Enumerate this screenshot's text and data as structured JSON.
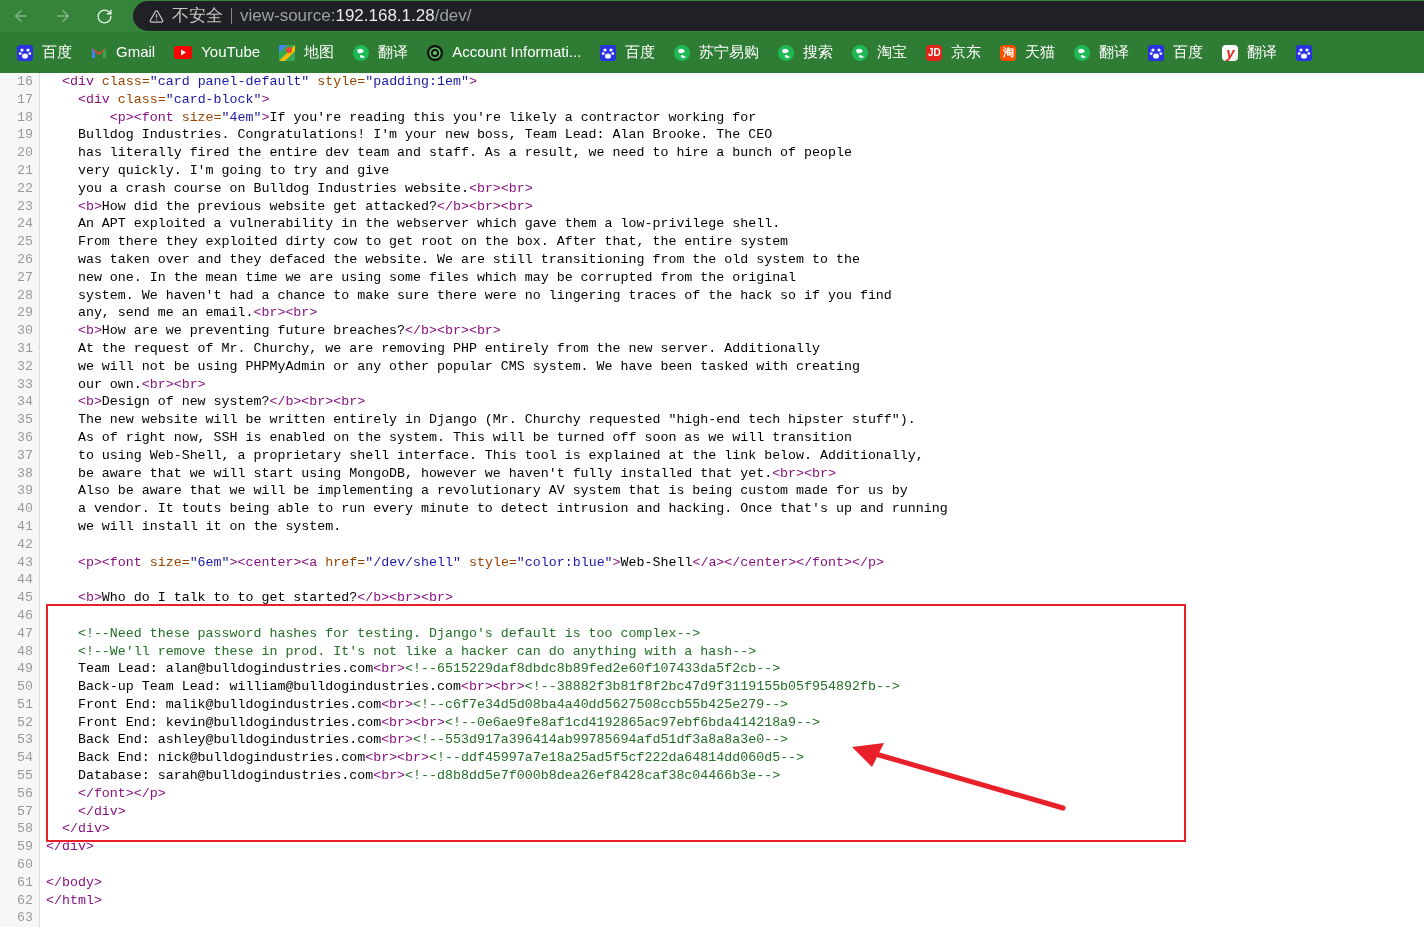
{
  "address_bar": {
    "security": "不安全",
    "scheme": "view-source:",
    "host": "192.168.1.28",
    "path": "/dev/"
  },
  "bookmarks": [
    {
      "kind": "paw",
      "label": "百度"
    },
    {
      "kind": "gmail",
      "label": "Gmail"
    },
    {
      "kind": "play",
      "label": "YouTube"
    },
    {
      "kind": "map",
      "label": "地图"
    },
    {
      "kind": "globe",
      "label": "翻译"
    },
    {
      "kind": "swirl",
      "label": "Account Informati..."
    },
    {
      "kind": "paw",
      "label": "百度"
    },
    {
      "kind": "globe",
      "label": "苏宁易购"
    },
    {
      "kind": "globe",
      "label": "搜索"
    },
    {
      "kind": "globe",
      "label": "淘宝"
    },
    {
      "kind": "letter-red",
      "icon_text": "JD",
      "label": "京东"
    },
    {
      "kind": "letter-orange",
      "icon_text": "淘",
      "label": "天猫"
    },
    {
      "kind": "globe",
      "label": "翻译"
    },
    {
      "kind": "paw",
      "label": "百度"
    },
    {
      "kind": "letter-plain",
      "icon_text": "y",
      "label": "翻译"
    },
    {
      "kind": "paw"
    }
  ],
  "source_lines": [
    {
      "number": "16",
      "segments": [
        {
          "kind": "tag",
          "text": "  <div "
        },
        {
          "kind": "attr",
          "text": "class="
        },
        {
          "kind": "value",
          "text": "\"card panel-default\""
        },
        {
          "kind": "attr",
          "text": " style="
        },
        {
          "kind": "value",
          "text": "\"padding:1em\""
        },
        {
          "kind": "tag",
          "text": ">"
        }
      ]
    },
    {
      "number": "17",
      "segments": [
        {
          "kind": "tag",
          "text": "    <div "
        },
        {
          "kind": "attr",
          "text": "class="
        },
        {
          "kind": "value",
          "text": "\"card-block\""
        },
        {
          "kind": "tag",
          "text": ">"
        }
      ]
    },
    {
      "number": "18",
      "segments": [
        {
          "kind": "tag",
          "text": "        <p><font "
        },
        {
          "kind": "attr",
          "text": "size="
        },
        {
          "kind": "value",
          "text": "\"4em\""
        },
        {
          "kind": "tag",
          "text": ">"
        },
        {
          "kind": "text",
          "text": "If you're reading this you're likely a contractor working for"
        }
      ]
    },
    {
      "number": "19",
      "segments": [
        {
          "kind": "text",
          "text": "    Bulldog Industries. Congratulations! I'm your new boss, Team Lead: Alan Brooke. The CEO"
        }
      ]
    },
    {
      "number": "20",
      "segments": [
        {
          "kind": "text",
          "text": "    has literally fired the entire dev team and staff. As a result, we need to hire a bunch of people"
        }
      ]
    },
    {
      "number": "21",
      "segments": [
        {
          "kind": "text",
          "text": "    very quickly. I'm going to try and give"
        }
      ]
    },
    {
      "number": "22",
      "segments": [
        {
          "kind": "text",
          "text": "    you a crash course on Bulldog Industries website."
        },
        {
          "kind": "tag",
          "text": "<br><br>"
        }
      ]
    },
    {
      "number": "23",
      "segments": [
        {
          "kind": "tag",
          "text": "    <b>"
        },
        {
          "kind": "text",
          "text": "How did the previous website get attacked?"
        },
        {
          "kind": "tag",
          "text": "</b><br><br>"
        }
      ]
    },
    {
      "number": "24",
      "segments": [
        {
          "kind": "text",
          "text": "    An APT exploited a vulnerability in the webserver which gave them a low-privilege shell."
        }
      ]
    },
    {
      "number": "25",
      "segments": [
        {
          "kind": "text",
          "text": "    From there they exploited dirty cow to get root on the box. After that, the entire system"
        }
      ]
    },
    {
      "number": "26",
      "segments": [
        {
          "kind": "text",
          "text": "    was taken over and they defaced the website. We are still transitioning from the old system to the"
        }
      ]
    },
    {
      "number": "27",
      "segments": [
        {
          "kind": "text",
          "text": "    new one. In the mean time we are using some files which may be corrupted from the original"
        }
      ]
    },
    {
      "number": "28",
      "segments": [
        {
          "kind": "text",
          "text": "    system. We haven't had a chance to make sure there were no lingering traces of the hack so if you find"
        }
      ]
    },
    {
      "number": "29",
      "segments": [
        {
          "kind": "text",
          "text": "    any, send me an email."
        },
        {
          "kind": "tag",
          "text": "<br><br>"
        }
      ]
    },
    {
      "number": "30",
      "segments": [
        {
          "kind": "tag",
          "text": "    <b>"
        },
        {
          "kind": "text",
          "text": "How are we preventing future breaches?"
        },
        {
          "kind": "tag",
          "text": "</b><br><br>"
        }
      ]
    },
    {
      "number": "31",
      "segments": [
        {
          "kind": "text",
          "text": "    At the request of Mr. Churchy, we are removing PHP entirely from the new server. Additionally"
        }
      ]
    },
    {
      "number": "32",
      "segments": [
        {
          "kind": "text",
          "text": "    we will not be using PHPMyAdmin or any other popular CMS system. We have been tasked with creating"
        }
      ]
    },
    {
      "number": "33",
      "segments": [
        {
          "kind": "text",
          "text": "    our own."
        },
        {
          "kind": "tag",
          "text": "<br><br>"
        }
      ]
    },
    {
      "number": "34",
      "segments": [
        {
          "kind": "tag",
          "text": "    <b>"
        },
        {
          "kind": "text",
          "text": "Design of new system?"
        },
        {
          "kind": "tag",
          "text": "</b><br><br>"
        }
      ]
    },
    {
      "number": "35",
      "segments": [
        {
          "kind": "text",
          "text": "    The new website will be written entirely in Django (Mr. Churchy requested \"high-end tech hipster stuff\")."
        }
      ]
    },
    {
      "number": "36",
      "segments": [
        {
          "kind": "text",
          "text": "    As of right now, SSH is enabled on the system. This will be turned off soon as we will transition"
        }
      ]
    },
    {
      "number": "37",
      "segments": [
        {
          "kind": "text",
          "text": "    to using Web-Shell, a proprietary shell interface. This tool is explained at the link below. Additionally,"
        }
      ]
    },
    {
      "number": "38",
      "segments": [
        {
          "kind": "text",
          "text": "    be aware that we will start using MongoDB, however we haven't fully installed that yet."
        },
        {
          "kind": "tag",
          "text": "<br><br>"
        }
      ]
    },
    {
      "number": "39",
      "segments": [
        {
          "kind": "text",
          "text": "    Also be aware that we will be implementing a revolutionary AV system that is being custom made for us by"
        }
      ]
    },
    {
      "number": "40",
      "segments": [
        {
          "kind": "text",
          "text": "    a vendor. It touts being able to run every minute to detect intrusion and hacking. Once that's up and running"
        }
      ]
    },
    {
      "number": "41",
      "segments": [
        {
          "kind": "text",
          "text": "    we will install it on the system."
        }
      ]
    },
    {
      "number": "42"
    },
    {
      "number": "43",
      "segments": [
        {
          "kind": "tag",
          "text": "    <p><font "
        },
        {
          "kind": "attr",
          "text": "size="
        },
        {
          "kind": "value",
          "text": "\"6em\""
        },
        {
          "kind": "tag",
          "text": "><center><a "
        },
        {
          "kind": "attr",
          "text": "href="
        },
        {
          "kind": "value",
          "text": "\"/dev/shell\""
        },
        {
          "kind": "attr",
          "text": " style="
        },
        {
          "kind": "value",
          "text": "\"color:blue\""
        },
        {
          "kind": "tag",
          "text": ">"
        },
        {
          "kind": "text",
          "text": "Web-Shell"
        },
        {
          "kind": "tag",
          "text": "</a></center></font></p>"
        }
      ]
    },
    {
      "number": "44"
    },
    {
      "number": "45",
      "segments": [
        {
          "kind": "tag",
          "text": "    <b>"
        },
        {
          "kind": "text",
          "text": "Who do I talk to to get started?"
        },
        {
          "kind": "tag",
          "text": "</b><br><br>"
        }
      ]
    },
    {
      "number": "46"
    },
    {
      "number": "47",
      "segments": [
        {
          "kind": "comment",
          "text": "    <!--Need these password hashes for testing. Django's default is too complex-->"
        }
      ]
    },
    {
      "number": "48",
      "segments": [
        {
          "kind": "comment",
          "text": "    <!--We'll remove these in prod. It's not like a hacker can do anything with a hash-->"
        }
      ]
    },
    {
      "number": "49",
      "segments": [
        {
          "kind": "text",
          "text": "    Team Lead: alan@bulldogindustries.com"
        },
        {
          "kind": "tag",
          "text": "<br>"
        },
        {
          "kind": "comment",
          "text": "<!--6515229daf8dbdc8b89fed2e60f107433da5f2cb-->"
        }
      ]
    },
    {
      "number": "50",
      "segments": [
        {
          "kind": "text",
          "text": "    Back-up Team Lead: william@bulldogindustries.com"
        },
        {
          "kind": "tag",
          "text": "<br><br>"
        },
        {
          "kind": "comment",
          "text": "<!--38882f3b81f8f2bc47d9f3119155b05f954892fb-->"
        }
      ]
    },
    {
      "number": "51",
      "segments": [
        {
          "kind": "text",
          "text": "    Front End: malik@bulldogindustries.com"
        },
        {
          "kind": "tag",
          "text": "<br>"
        },
        {
          "kind": "comment",
          "text": "<!--c6f7e34d5d08ba4a40dd5627508ccb55b425e279-->"
        }
      ]
    },
    {
      "number": "52",
      "segments": [
        {
          "kind": "text",
          "text": "    Front End: kevin@bulldogindustries.com"
        },
        {
          "kind": "tag",
          "text": "<br><br>"
        },
        {
          "kind": "comment",
          "text": "<!--0e6ae9fe8af1cd4192865ac97ebf6bda414218a9-->"
        }
      ]
    },
    {
      "number": "53",
      "segments": [
        {
          "kind": "text",
          "text": "    Back End: ashley@bulldogindustries.com"
        },
        {
          "kind": "tag",
          "text": "<br>"
        },
        {
          "kind": "comment",
          "text": "<!--553d917a396414ab99785694afd51df3a8a8a3e0-->"
        }
      ]
    },
    {
      "number": "54",
      "segments": [
        {
          "kind": "text",
          "text": "    Back End: nick@bulldogindustries.com"
        },
        {
          "kind": "tag",
          "text": "<br><br>"
        },
        {
          "kind": "comment",
          "text": "<!--ddf45997a7e18a25ad5f5cf222da64814dd060d5-->"
        }
      ]
    },
    {
      "number": "55",
      "segments": [
        {
          "kind": "text",
          "text": "    Database: sarah@bulldogindustries.com"
        },
        {
          "kind": "tag",
          "text": "<br>"
        },
        {
          "kind": "comment",
          "text": "<!--d8b8dd5e7f000b8dea26ef8428caf38c04466b3e-->"
        }
      ]
    },
    {
      "number": "56",
      "segments": [
        {
          "kind": "tag",
          "text": "    </font></p>"
        }
      ]
    },
    {
      "number": "57",
      "segments": [
        {
          "kind": "tag",
          "text": "    </div>"
        }
      ]
    },
    {
      "number": "58",
      "segments": [
        {
          "kind": "tag",
          "text": "  </div>"
        }
      ]
    },
    {
      "number": "59",
      "segments": [
        {
          "kind": "tag",
          "text": "</div>"
        }
      ]
    },
    {
      "number": "60"
    },
    {
      "number": "61",
      "segments": [
        {
          "kind": "tag",
          "text": "</body>"
        }
      ]
    },
    {
      "number": "62",
      "segments": [
        {
          "kind": "tag",
          "text": "</html>"
        }
      ]
    },
    {
      "number": "63"
    }
  ]
}
